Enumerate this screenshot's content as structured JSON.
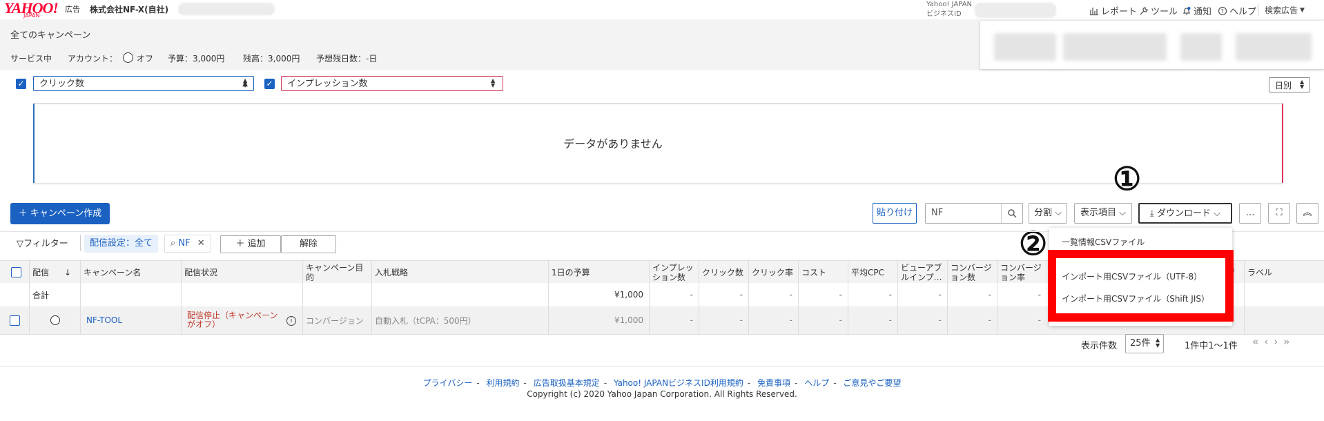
{
  "header": {
    "logo": "YAHOO!",
    "logo_sub": "JAPAN",
    "ad_label": "広告",
    "account_name": "株式会社NF-X(自社)",
    "yid_line1": "Yahoo! JAPAN",
    "yid_line2": "ビジネスID",
    "nav": {
      "report": "レポート",
      "tool": "ツール",
      "notice": "通知",
      "help": "ヘルプ",
      "search_ads": "検索広告"
    }
  },
  "summary": {
    "title": "全てのキャンペーン",
    "status": "サービス中",
    "account_label": "アカウント：",
    "account_value": "オフ",
    "budget": "予算：3,000円",
    "remaining": "残高：3,000円",
    "days_left": "予想残日数：-日"
  },
  "chart": {
    "metric1": "クリック数",
    "metric2": "インプレッション数",
    "period": "日別",
    "empty_message": "データがありません"
  },
  "toolbar": {
    "create_campaign": "＋ キャンペーン作成",
    "paste": "貼り付け",
    "search_value": "NF",
    "split": "分割",
    "columns": "表示項目",
    "download": "ダウンロード",
    "more": "…",
    "annotation1": "①",
    "annotation2": "②"
  },
  "download_menu": {
    "items": [
      "一覧情報CSVファイル",
      "インポート用CSVファイル（UTF-8）",
      "インポート用CSVファイル（Shift JIS）"
    ]
  },
  "filter": {
    "label": "フィルター",
    "chip1": "配信設定：全て",
    "chip2": "NF",
    "add": "＋ 追加",
    "clear": "解除"
  },
  "table": {
    "headers": [
      "配信",
      "キャンペーン名",
      "配信状況",
      "キャンペーン目的",
      "入札戦略",
      "1日の予算",
      "インプレッション数",
      "クリック数",
      "クリック率",
      "コスト",
      "平均CPC",
      "ビューアブルインプ…",
      "コンバージョン数",
      "コンバージョン率",
      "ジ",
      "ラベル"
    ],
    "total": {
      "label": "合計",
      "budget": "¥1,000",
      "dash": "-"
    },
    "rows": [
      {
        "name": "NF-TOOL",
        "status": "配信停止（キャンペーンがオフ）",
        "objective": "コンバージョン",
        "bidding": "自動入札（tCPA：500円）",
        "budget": "¥1,000",
        "dash": "-"
      }
    ]
  },
  "pager": {
    "label": "表示件数",
    "per_page": "25件",
    "range": "1件中1〜1件"
  },
  "footer": {
    "links": [
      "プライバシー",
      "利用規約",
      "広告取扱基本規定",
      "Yahoo! JAPANビジネスID利用規約",
      "免責事項",
      "ヘルプ",
      "ご意見やご要望"
    ],
    "copyright": "Copyright (c) 2020 Yahoo Japan Corporation. All Rights Reserved."
  },
  "colors": {
    "primary": "#1a61c2",
    "brand": "#ff0033",
    "highlight": "#ff0000",
    "status_stopped": "#c0392b"
  }
}
